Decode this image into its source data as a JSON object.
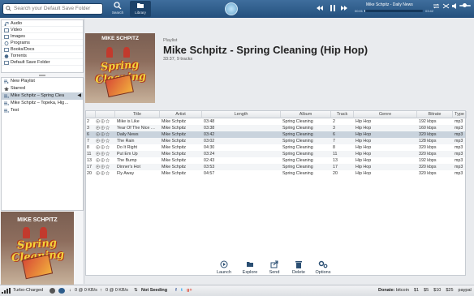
{
  "topbar": {
    "search_placeholder": "Search your Default Save Folder",
    "search_label": "Search",
    "library_label": "Library",
    "now_playing": "Mike Schpitz - Daily News",
    "time_elapsed": "00:01",
    "time_total": "03:42",
    "progress": 0.01
  },
  "sources": [
    {
      "label": "Audio",
      "icon": "music-note-icon"
    },
    {
      "label": "Video",
      "icon": "film-icon"
    },
    {
      "label": "Images",
      "icon": "image-icon"
    },
    {
      "label": "Programs",
      "icon": "gear-icon"
    },
    {
      "label": "Books/Docs",
      "icon": "book-icon"
    },
    {
      "label": "Torrents",
      "icon": "torrent-icon"
    },
    {
      "label": "Default Save Folder",
      "icon": "folder-icon"
    }
  ],
  "playlists": [
    {
      "label": "New Playlist",
      "icon": "add-icon"
    },
    {
      "label": "Starred",
      "icon": "star-icon"
    },
    {
      "label": "Mike Schpitz – Spring Clea",
      "icon": "playlist-icon",
      "selected": true
    },
    {
      "label": "Mike Schpitz – Topeka, Hig…",
      "icon": "playlist-icon"
    },
    {
      "label": "Test",
      "icon": "playlist-icon"
    }
  ],
  "album_art": {
    "artist": "MIKE SCHPITZ",
    "title": "Spring Cleaning"
  },
  "header": {
    "label": "Playlist",
    "title": "Mike Schpitz - Spring Cleaning (Hip Hop)",
    "meta": "33:37, 9 tracks"
  },
  "table": {
    "columns": [
      "Title",
      "Artist",
      "Length",
      "Album",
      "Track",
      "Genre",
      "Bitrate",
      "Type"
    ],
    "rows": [
      {
        "n": "2",
        "title": "Mike is Like",
        "artist": "Mike Schpitz",
        "length": "03:48",
        "album": "Spring Cleaning",
        "track": "2",
        "genre": "Hip Hop",
        "bitrate": "192 kbps",
        "type": "mp3"
      },
      {
        "n": "3",
        "title": "Year Of The Nice …",
        "artist": "Mike Schpitz",
        "length": "03:38",
        "album": "Spring Cleaning",
        "track": "3",
        "genre": "Hip Hop",
        "bitrate": "160 kbps",
        "type": "mp3"
      },
      {
        "n": "6",
        "title": "Daily News",
        "artist": "Mike Schpitz",
        "length": "03:42",
        "album": "Spring Cleaning",
        "track": "6",
        "genre": "Hip Hop",
        "bitrate": "320 kbps",
        "type": "mp3",
        "playing": true
      },
      {
        "n": "7",
        "title": "The Rain",
        "artist": "Mike Schpitz",
        "length": "03:02",
        "album": "Spring Cleaning",
        "track": "7",
        "genre": "Hip Hop",
        "bitrate": "128 kbps",
        "type": "mp3"
      },
      {
        "n": "8",
        "title": "Do It Right",
        "artist": "Mike Schpitz",
        "length": "04:30",
        "album": "Spring Cleaning",
        "track": "8",
        "genre": "Hip Hop",
        "bitrate": "320 kbps",
        "type": "mp3"
      },
      {
        "n": "11",
        "title": "Put Em Up",
        "artist": "Mike Schpitz",
        "length": "03:24",
        "album": "Spring Cleaning",
        "track": "11",
        "genre": "Hip Hop",
        "bitrate": "320 kbps",
        "type": "mp3"
      },
      {
        "n": "13",
        "title": "The Bump",
        "artist": "Mike Schpitz",
        "length": "02:43",
        "album": "Spring Cleaning",
        "track": "13",
        "genre": "Hip Hop",
        "bitrate": "192 kbps",
        "type": "mp3"
      },
      {
        "n": "17",
        "title": "Dinner's Hot",
        "artist": "Mike Schpitz",
        "length": "03:53",
        "album": "Spring Cleaning",
        "track": "17",
        "genre": "Hip Hop",
        "bitrate": "320 kbps",
        "type": "mp3"
      },
      {
        "n": "20",
        "title": "Fly Away",
        "artist": "Mike Schpitz",
        "length": "04:57",
        "album": "Spring Cleaning",
        "track": "20",
        "genre": "Hip Hop",
        "bitrate": "320 kbps",
        "type": "mp3"
      }
    ]
  },
  "toolbar": {
    "launch": "Launch",
    "explore": "Explore",
    "send": "Send",
    "delete": "Delete",
    "options": "Options"
  },
  "status": {
    "connection": "Turbo-Charged",
    "down_speed": "0 @ 0 KB/s",
    "up_speed": "0 @ 0 KB/s",
    "seeding": "Not Seeding",
    "donate_label": "Donate:",
    "donate_options": [
      "bitcoin",
      "$1",
      "$5",
      "$10",
      "$25",
      "paypal"
    ]
  },
  "colors": {
    "topbar": "#2e5b88",
    "selection": "#c9d3dd",
    "accent": "#3f6e9d"
  }
}
